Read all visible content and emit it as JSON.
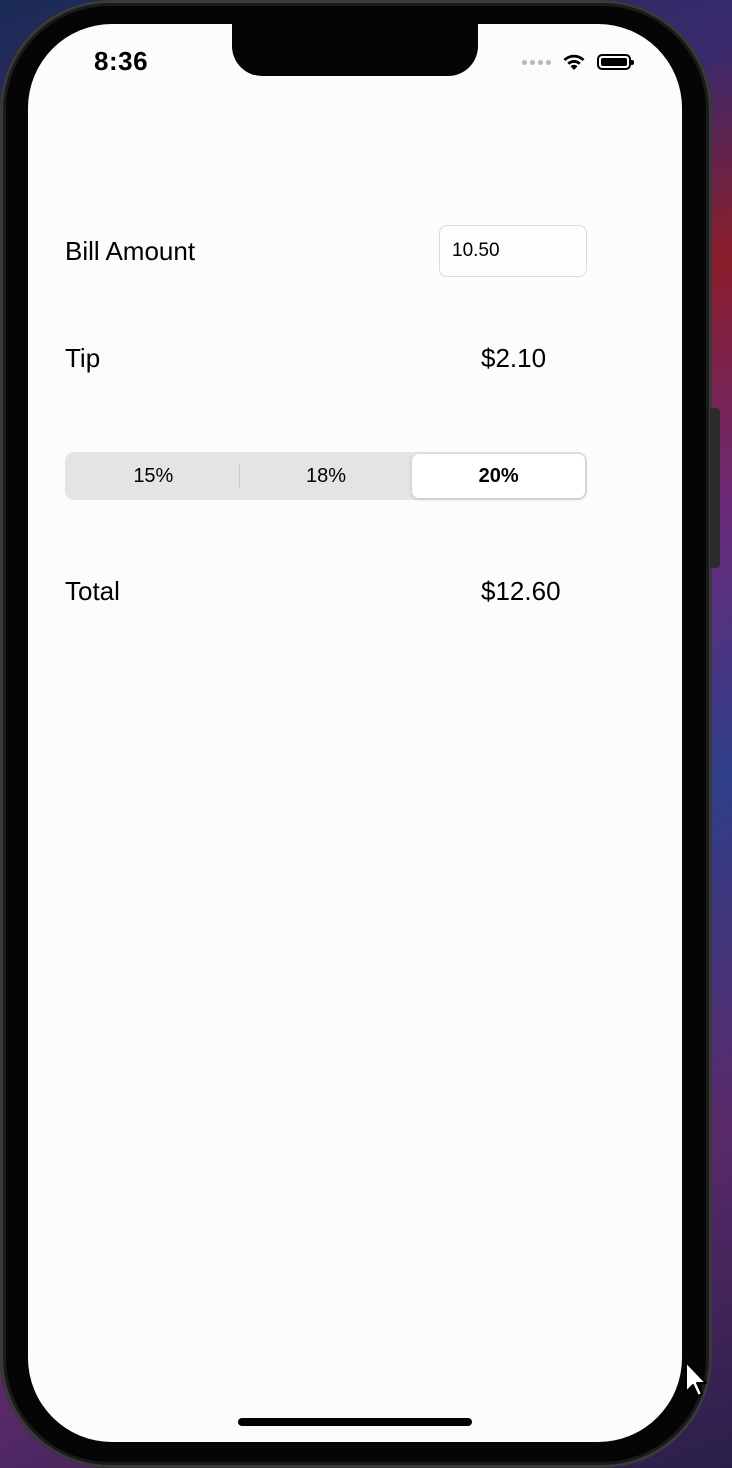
{
  "status_bar": {
    "time": "8:36"
  },
  "bill": {
    "label": "Bill Amount",
    "value": "10.50"
  },
  "tip": {
    "label": "Tip",
    "value": "$2.10"
  },
  "tip_options": {
    "items": [
      "15%",
      "18%",
      "20%"
    ],
    "selected": "20%"
  },
  "total": {
    "label": "Total",
    "value": "$12.60"
  },
  "icons": [
    "cellular-signal-icon",
    "wifi-icon",
    "battery-icon",
    "mouse-cursor-icon"
  ]
}
